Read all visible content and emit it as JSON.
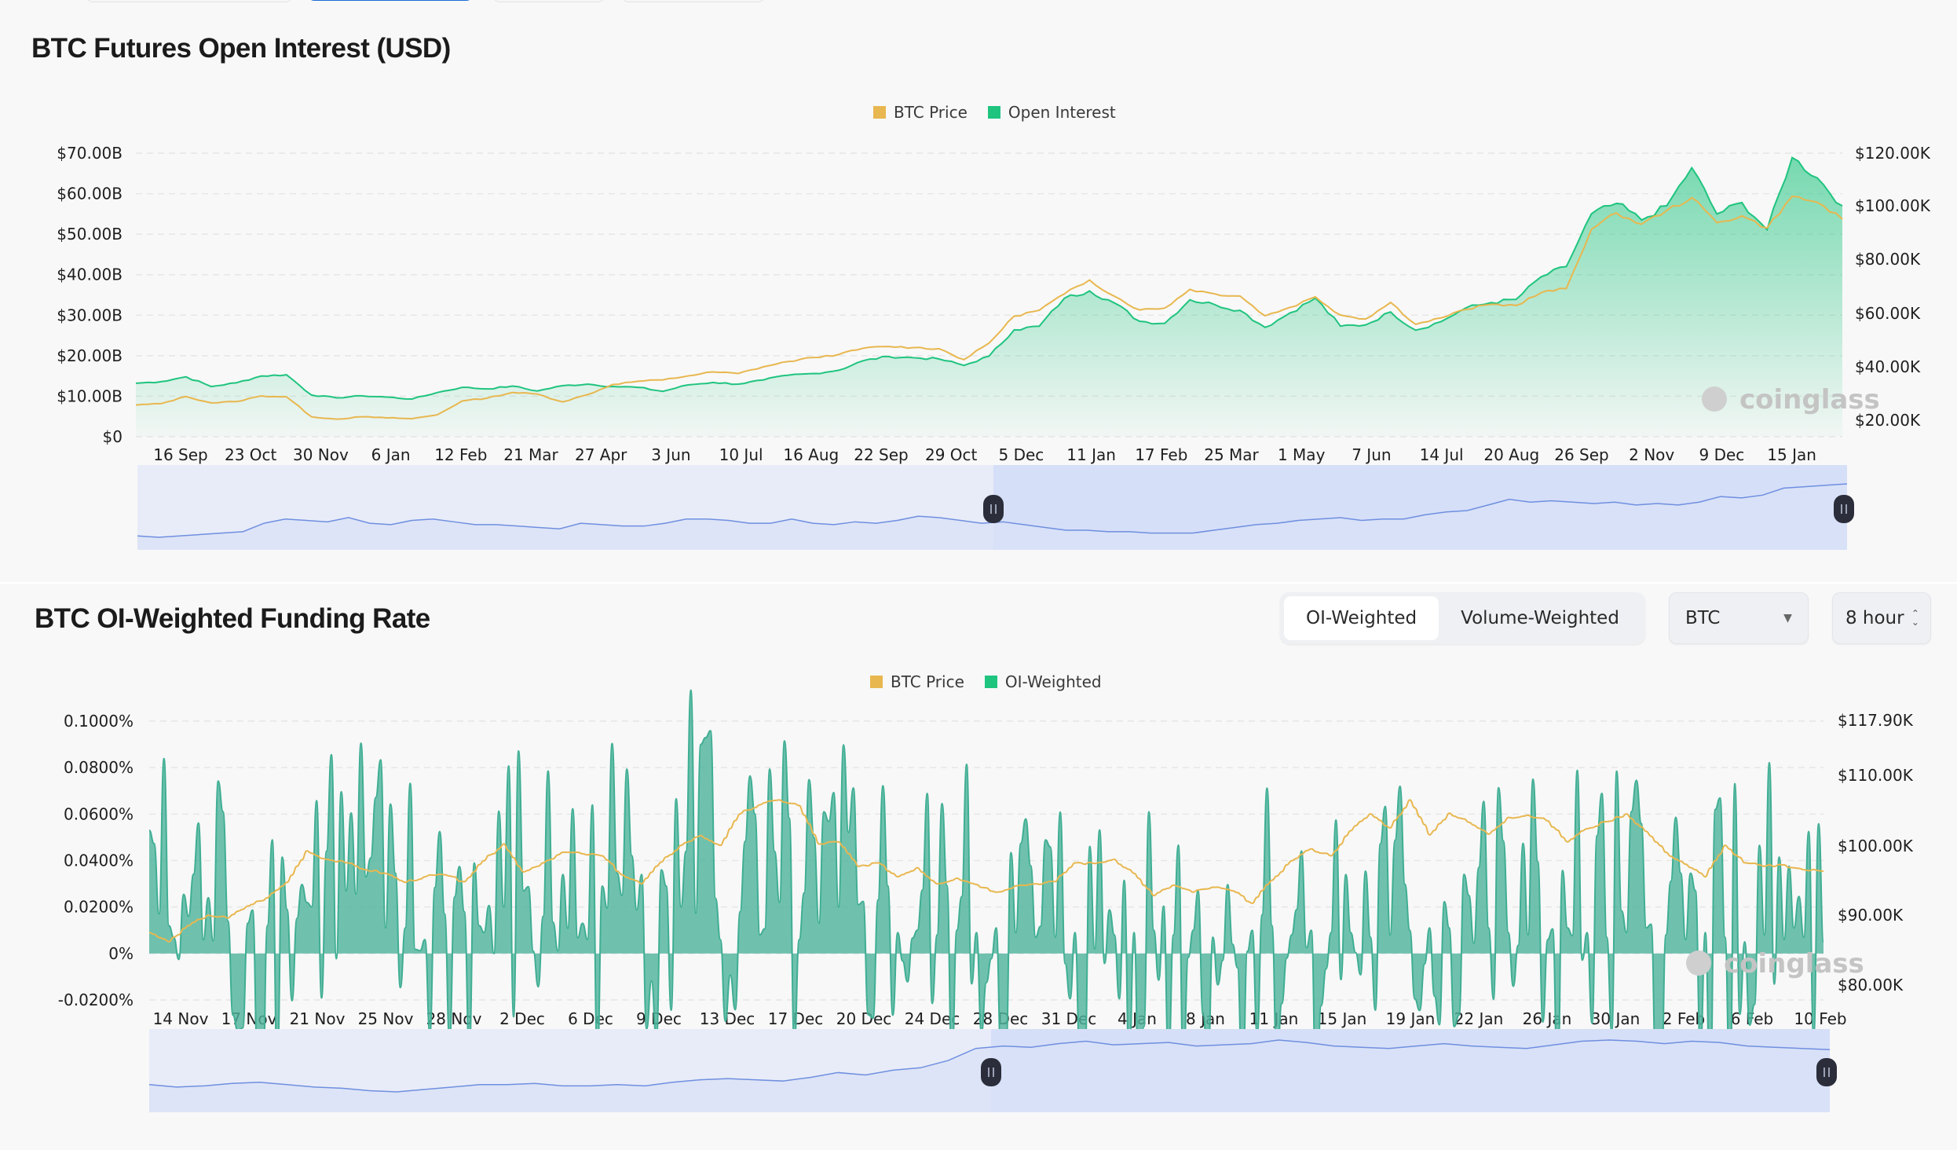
{
  "colors": {
    "price": "#e8b74f",
    "open_interest": "#1fc47f",
    "funding": "#4db39c",
    "navigator_line": "#6f8fe0",
    "navigator_fill": "#dfe5f7",
    "navigator_selected": "#d6dff8",
    "accent": "#1a6fd6"
  },
  "open_interest_section": {
    "title": "BTC Futures Open Interest (USD)",
    "legend": [
      {
        "label": "BTC Price",
        "color": "#e8b74f"
      },
      {
        "label": "Open Interest",
        "color": "#1fc47f"
      }
    ],
    "watermark": "coinglass"
  },
  "funding_section": {
    "title": "BTC OI-Weighted Funding Rate",
    "legend": [
      {
        "label": "BTC Price",
        "color": "#e8b74f"
      },
      {
        "label": "OI-Weighted",
        "color": "#1fc47f"
      }
    ],
    "segmented": [
      {
        "label": "OI-Weighted",
        "active": true
      },
      {
        "label": "Volume-Weighted",
        "active": false
      }
    ],
    "coin_select": {
      "value": "BTC"
    },
    "interval_select": {
      "value": "8 hour"
    },
    "watermark": "coinglass"
  },
  "chart_data": [
    {
      "type": "area",
      "title": "BTC Futures Open Interest (USD)",
      "legend_position": "top-center",
      "grid": true,
      "x": [
        "16 Sep",
        "23 Oct",
        "30 Nov",
        "6 Jan",
        "12 Feb",
        "21 Mar",
        "27 Apr",
        "3 Jun",
        "10 Jul",
        "16 Aug",
        "22 Sep",
        "29 Oct",
        "5 Dec",
        "11 Jan",
        "17 Feb",
        "25 Mar",
        "1 May",
        "7 Jun",
        "14 Jul",
        "20 Aug",
        "26 Sep",
        "2 Nov",
        "9 Dec",
        "15 Jan"
      ],
      "y_left": {
        "label": "Open Interest",
        "ticks": [
          "$0",
          "$10.00B",
          "$20.00B",
          "$30.00B",
          "$40.00B",
          "$50.00B",
          "$60.00B",
          "$70.00B"
        ],
        "range": [
          0,
          70
        ]
      },
      "y_right": {
        "label": "BTC Price",
        "ticks": [
          "$20.00K",
          "$40.00K",
          "$60.00K",
          "$80.00K",
          "$100.00K",
          "$120.00K"
        ],
        "range": [
          16,
          120
        ]
      },
      "series": [
        {
          "name": "Open Interest",
          "unit": "USD billions",
          "axis": "left",
          "values": [
            13.2,
            13.6,
            14.8,
            12.4,
            13.3,
            15.0,
            15.3,
            10.3,
            9.6,
            10.1,
            9.8,
            9.3,
            10.9,
            12.2,
            11.8,
            12.5,
            11.3,
            12.6,
            13.0,
            12.4,
            12.2,
            11.2,
            12.8,
            13.4,
            13.0,
            14.0,
            15.2,
            15.6,
            16.4,
            18.8,
            19.8,
            19.5,
            19.2,
            17.6,
            19.9,
            26.4,
            27.3,
            34.2,
            36.0,
            33.0,
            28.5,
            28.0,
            33.8,
            32.6,
            31.2,
            27.0,
            30.6,
            34.2,
            27.3,
            27.6,
            30.8,
            26.3,
            28.4,
            31.8,
            33.1,
            33.9,
            39.5,
            42.0,
            55.0,
            57.6,
            53.5,
            57.0,
            66.4,
            55.0,
            57.8,
            51.1,
            68.9,
            63.9,
            57.0
          ]
        },
        {
          "name": "BTC Price",
          "unit": "USD thousands",
          "axis": "right",
          "values": [
            25.7,
            26.2,
            28.9,
            26.5,
            27.0,
            29.1,
            28.8,
            21.3,
            20.4,
            21.3,
            20.9,
            20.6,
            22.0,
            27.2,
            28.3,
            30.4,
            29.8,
            26.9,
            29.6,
            33.4,
            34.6,
            35.1,
            36.6,
            38.1,
            37.5,
            40.0,
            42.0,
            43.5,
            44.6,
            47.0,
            47.6,
            47.2,
            46.8,
            42.7,
            48.9,
            59.0,
            61.2,
            67.3,
            72.5,
            66.4,
            61.3,
            62.0,
            69.0,
            67.3,
            66.5,
            59.1,
            62.3,
            66.2,
            59.4,
            57.9,
            64.1,
            55.9,
            58.3,
            61.5,
            63.4,
            63.0,
            67.8,
            69.3,
            91.5,
            97.6,
            93.4,
            98.5,
            103.3,
            94.0,
            96.5,
            92.0,
            103.8,
            101.6,
            95.3
          ]
        }
      ],
      "navigator": {
        "selected_range": [
          "5 Dec",
          "15 Jan"
        ]
      }
    },
    {
      "type": "area",
      "title": "BTC OI-Weighted Funding Rate",
      "legend_position": "top-center",
      "grid": true,
      "x": [
        "14 Nov",
        "17 Nov",
        "21 Nov",
        "25 Nov",
        "28 Nov",
        "2 Dec",
        "6 Dec",
        "9 Dec",
        "13 Dec",
        "17 Dec",
        "20 Dec",
        "24 Dec",
        "28 Dec",
        "31 Dec",
        "4 Jan",
        "8 Jan",
        "11 Jan",
        "15 Jan",
        "19 Jan",
        "22 Jan",
        "26 Jan",
        "30 Jan",
        "2 Feb",
        "6 Feb",
        "10 Feb"
      ],
      "y_left": {
        "label": "Funding Rate",
        "ticks": [
          "-0.0200%",
          "0%",
          "0.0200%",
          "0.0400%",
          "0.0600%",
          "0.0800%",
          "0.1000%"
        ],
        "range": [
          -0.02,
          0.1
        ]
      },
      "y_right": {
        "label": "BTC Price",
        "ticks": [
          "$80.00K",
          "$90.00K",
          "$100.00K",
          "$110.00K",
          "$117.90K"
        ],
        "range": [
          80,
          117.9
        ]
      },
      "series": [
        {
          "name": "OI-Weighted",
          "unit": "percent",
          "axis": "left",
          "values": [
            0.053,
            0.012,
            0.016,
            0.024,
            0.014,
            0.013,
            0.012,
            0.019,
            0.022,
            0.044,
            0.027,
            0.033,
            0.011,
            0.011,
            0.006,
            0.017,
            0.018,
            0.009,
            0.02,
            0.027,
            0.016,
            0.034,
            0.013,
            0.029,
            0.025,
            0.034,
            0.036,
            0.02,
            0.09,
            0.006,
            0.018,
            0.008,
            0.022,
            0.006,
            0.013,
            0.02,
            0.021,
            0.023,
            0.009,
            0.01,
            0.008,
            0.01,
            0.009,
            0.011,
            0.009,
            0.007,
            0.007,
            0.009,
            0.002,
            0.008,
            0.009,
            0.01,
            0.008,
            0.01,
            0.007,
            0.004,
            0.01,
            0.012,
            0.008,
            0.01,
            0.009,
            0.009,
            0.007,
            0.008,
            0.01,
            0.011,
            0.011,
            0.025,
            0.011,
            0.009,
            0.008,
            0.006,
            0.011,
            0.009,
            0.007,
            0.009,
            0.011,
            0.008,
            0.006,
            0.009,
            0.007,
            0.005,
            0.008,
            0.006,
            0.007,
            0.005
          ]
        },
        {
          "name": "BTC Price",
          "unit": "USD thousands",
          "axis": "right",
          "values": [
            87.5,
            86.2,
            88.5,
            90.0,
            89.6,
            91.3,
            92.5,
            94.7,
            99.2,
            98.0,
            97.5,
            96.5,
            96.0,
            94.7,
            95.5,
            95.8,
            94.8,
            97.8,
            100.2,
            96.2,
            97.5,
            99.0,
            98.8,
            98.5,
            95.8,
            94.5,
            97.6,
            100.0,
            101.4,
            100.0,
            104.5,
            105.8,
            106.5,
            105.7,
            100.2,
            100.5,
            97.0,
            97.5,
            95.5,
            96.8,
            94.5,
            95.3,
            94.4,
            93.3,
            94.2,
            94.5,
            94.8,
            97.5,
            97.4,
            98.0,
            96.0,
            92.8,
            94.3,
            93.3,
            94.0,
            93.5,
            91.7,
            95.0,
            97.8,
            99.5,
            98.5,
            102.1,
            104.5,
            102.5,
            106.5,
            101.5,
            104.6,
            103.3,
            101.6,
            104.0,
            104.3,
            103.5,
            100.5,
            102.4,
            103.4,
            104.5,
            102.0,
            99.0,
            97.3,
            95.5,
            100.0,
            97.5,
            97.0,
            97.2,
            96.5,
            96.3
          ]
        }
      ],
      "navigator": {
        "selected_range": [
          "28 Dec",
          "10 Feb"
        ]
      }
    }
  ]
}
